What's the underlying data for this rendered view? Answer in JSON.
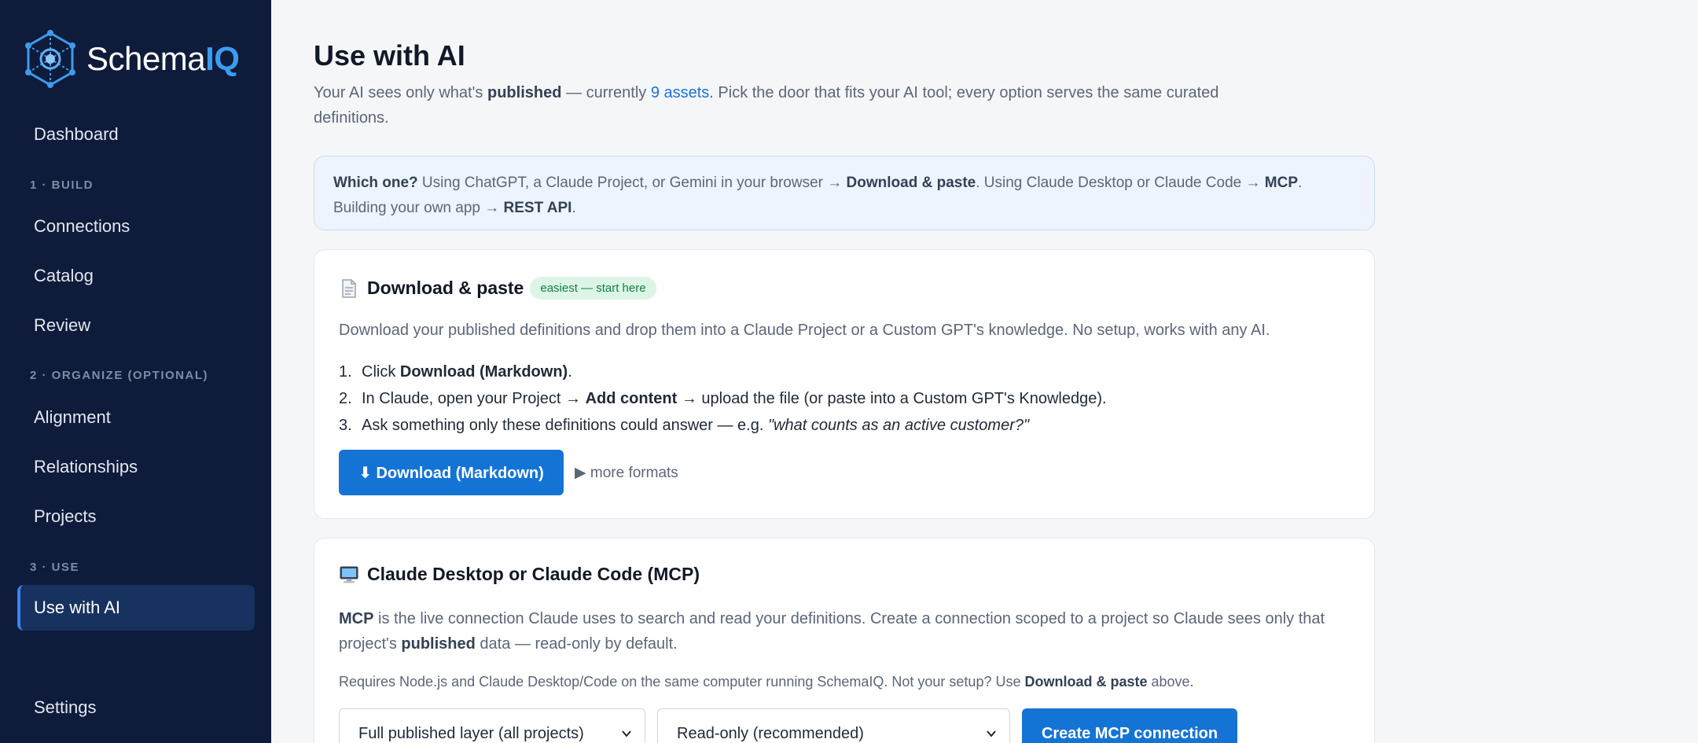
{
  "brand": {
    "name_prefix": "Schema",
    "name_suffix": "IQ"
  },
  "sidebar": {
    "dashboard": "Dashboard",
    "section_build": "1 · BUILD",
    "connections": "Connections",
    "catalog": "Catalog",
    "review": "Review",
    "section_organize": "2 · ORGANIZE (OPTIONAL)",
    "alignment": "Alignment",
    "relationships": "Relationships",
    "projects": "Projects",
    "section_use": "3 · USE",
    "use_with_ai": "Use with AI",
    "settings": "Settings"
  },
  "page": {
    "title": "Use with AI",
    "intro_1": "Your AI sees only what's ",
    "intro_bold": "published",
    "intro_2": " — currently ",
    "intro_link": "9 assets",
    "intro_3": ". Pick the door that fits your AI tool; every option serves the same curated definitions."
  },
  "hint": {
    "q": "Which one?",
    "t1": " Using ChatGPT, a Claude Project, or Gemini in your browser → ",
    "b1": "Download & paste",
    "t2": ". Using Claude Desktop or Claude Code → ",
    "b2": "MCP",
    "t3": ". Building your own app → ",
    "b3": "REST API",
    "t4": "."
  },
  "download_card": {
    "icon": "document-icon",
    "title": "Download & paste",
    "badge": "easiest — start here",
    "description": "Download your published definitions and drop them into a Claude Project or a Custom GPT's knowledge. No setup, works with any AI.",
    "step1_num": "1.",
    "step1_a": "Click ",
    "step1_b": "Download (Markdown)",
    "step1_c": ".",
    "step2_num": "2.",
    "step2_a": "In Claude, open your Project → ",
    "step2_b": "Add content",
    "step2_c": " → upload the file (or paste into a Custom GPT's Knowledge).",
    "step3_num": "3.",
    "step3_a": "Ask something only these definitions could answer — e.g. ",
    "step3_i": "\"what counts as an active customer?\"",
    "button": "⬇ Download (Markdown)",
    "more": "▶ more formats"
  },
  "mcp_card": {
    "icon": "computer-icon",
    "title": "Claude Desktop or Claude Code (MCP)",
    "d_b1": "MCP",
    "d_1": " is the live connection Claude uses to search and read your definitions. Create a connection scoped to a project so Claude sees only that project's ",
    "d_b2": "published",
    "d_2": " data — read-only by default.",
    "note_1": "Requires Node.js and Claude Desktop/Code on the same computer running SchemaIQ. Not your setup? Use ",
    "note_b": "Download & paste",
    "note_2": " above.",
    "scope_select": "Full published layer (all projects)",
    "access_select": "Read-only (recommended)",
    "button": "Create MCP connection"
  }
}
